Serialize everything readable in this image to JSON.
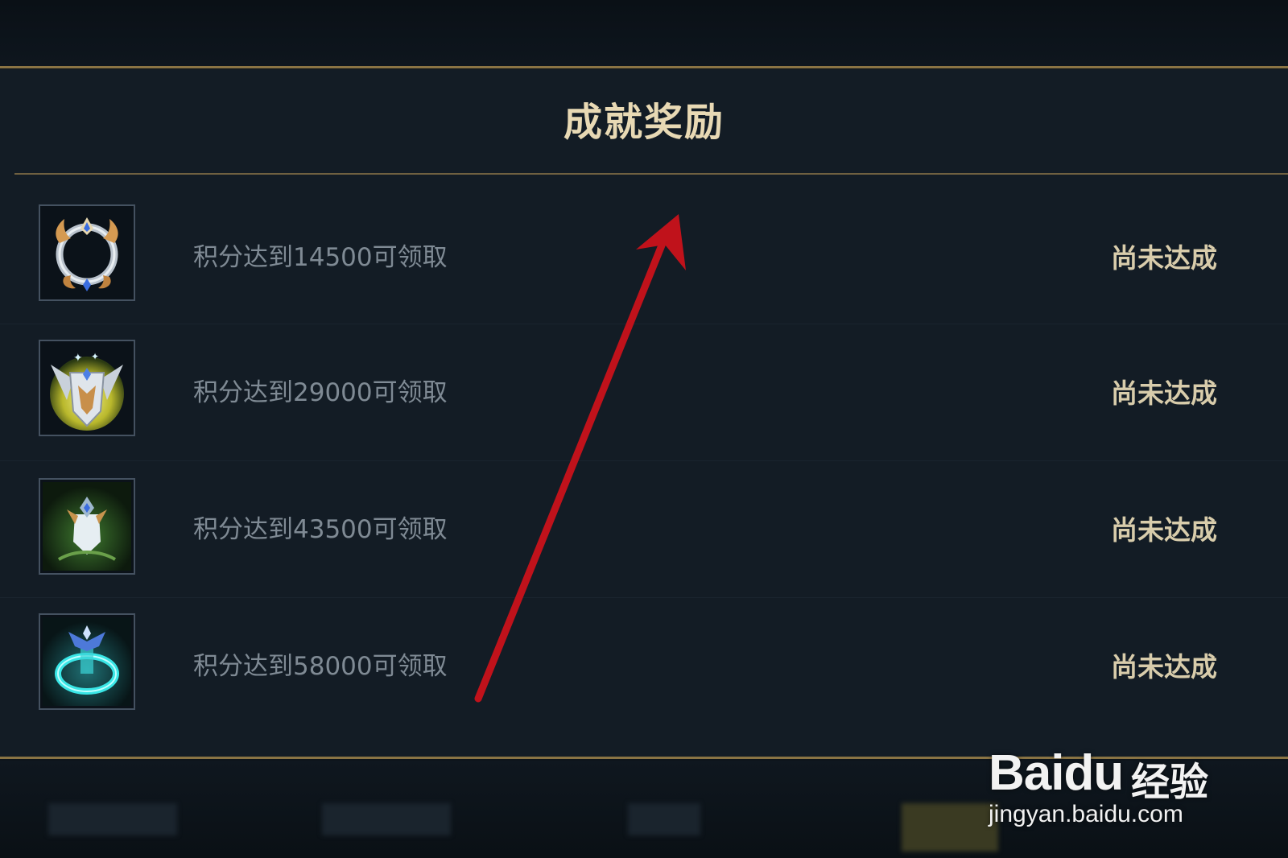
{
  "panel": {
    "title": "成就奖励",
    "rows": [
      {
        "text": "积分达到14500可领取",
        "status": "尚未达成",
        "icon": "silver-ring-frame-icon"
      },
      {
        "text": "积分达到29000可领取",
        "status": "尚未达成",
        "icon": "winged-shield-icon"
      },
      {
        "text": "积分达到43500可领取",
        "status": "尚未达成",
        "icon": "crystal-crest-icon"
      },
      {
        "text": "积分达到58000可领取",
        "status": "尚未达成",
        "icon": "teal-portal-ring-icon"
      }
    ]
  },
  "watermark": {
    "logo": "Baidu",
    "cn": "经验",
    "url": "jingyan.baidu.com"
  },
  "colors": {
    "background": "#131c25",
    "gold_line": "#8a7444",
    "title": "#e8d9b4",
    "status": "#d8ccab",
    "annotation_arrow": "#c0121b"
  }
}
